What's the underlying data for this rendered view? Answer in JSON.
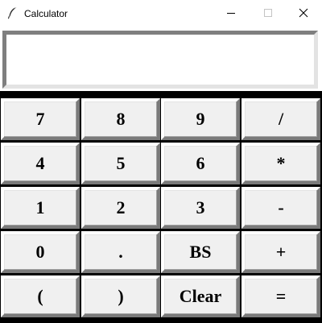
{
  "window": {
    "title": "Calculator",
    "app_icon": "feather-icon",
    "controls": {
      "minimize_icon": "minimize-icon",
      "maximize_icon": "maximize-icon",
      "close_icon": "close-icon"
    }
  },
  "display": {
    "value": ""
  },
  "keypad": {
    "rows": [
      [
        "7",
        "8",
        "9",
        "/"
      ],
      [
        "4",
        "5",
        "6",
        "*"
      ],
      [
        "1",
        "2",
        "3",
        "-"
      ],
      [
        "0",
        ".",
        "BS",
        "+"
      ],
      [
        "(",
        ")",
        "Clear",
        "="
      ]
    ]
  }
}
